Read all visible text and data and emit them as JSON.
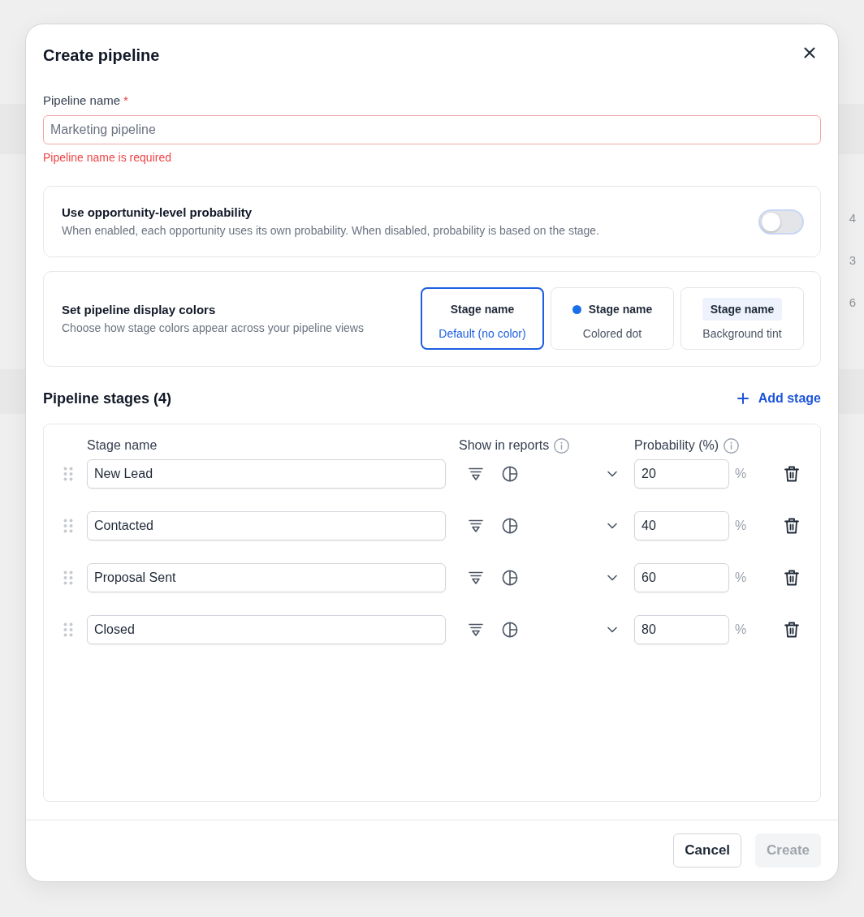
{
  "dialog": {
    "title": "Create pipeline"
  },
  "pipeline_name": {
    "label": "Pipeline name",
    "required_mark": "*",
    "placeholder": "Marketing pipeline",
    "invalid": true,
    "error": "Pipeline name is required"
  },
  "use_probability": {
    "title": "Use opportunity-level probability",
    "description": "When enabled, each opportunity uses its own probability. When disabled, probability is based on the stage.",
    "on": false
  },
  "display_colors": {
    "title": "Set pipeline display colors",
    "description": "Choose how stage colors appear across your pipeline views",
    "options": [
      {
        "kind": "plain",
        "preview": "Stage name",
        "caption": "Default (no color)",
        "selected": true
      },
      {
        "kind": "dot",
        "preview": "Stage name",
        "caption": "Colored dot",
        "color": "#1a6fe8",
        "selected": false
      },
      {
        "kind": "tint",
        "preview": "Stage name",
        "caption": "Background tint",
        "selected": false
      }
    ]
  },
  "stages": {
    "title": "Pipeline stages (4)",
    "add_label": "Add stage",
    "columns": [
      "Stage name",
      "Show in reports",
      "Probability (%)"
    ],
    "rows": [
      {
        "name": "New Lead",
        "probability": "20",
        "unit": "%"
      },
      {
        "name": "Contacted",
        "probability": "40",
        "unit": "%"
      },
      {
        "name": "Proposal Sent",
        "probability": "60",
        "unit": "%"
      },
      {
        "name": "Closed",
        "probability": "80",
        "unit": "%"
      }
    ]
  },
  "footer": {
    "buttons": [
      {
        "label": "Cancel",
        "kind": "secondary",
        "disabled": false
      },
      {
        "label": "Create",
        "kind": "primary",
        "disabled": true
      }
    ]
  },
  "backdrop": {
    "values": [
      "4",
      "3",
      "6"
    ]
  }
}
